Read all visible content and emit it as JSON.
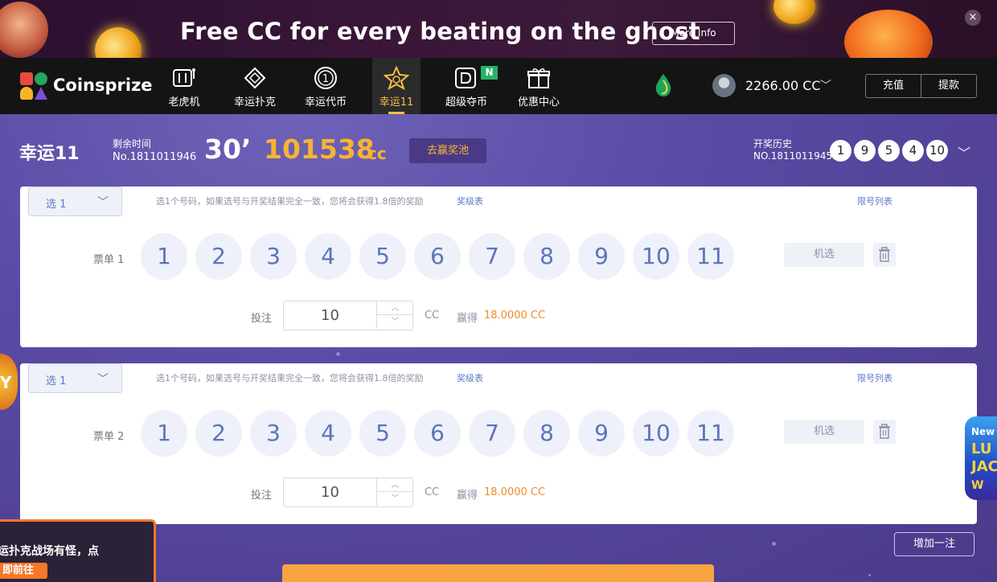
{
  "banner": {
    "title": "Free CC for every beating on the ghost",
    "more_info": "More Info",
    "close": "×"
  },
  "nav": {
    "logo_text": "Coinsprize",
    "items": [
      {
        "label": "老虎机",
        "icon": "slot-machine-icon"
      },
      {
        "label": "幸运扑克",
        "icon": "poker-icon"
      },
      {
        "label": "幸运代币",
        "icon": "coin-icon"
      },
      {
        "label": "幸运11",
        "icon": "star-icon"
      },
      {
        "label": "超级夺币",
        "icon": "super-coin-icon"
      },
      {
        "label": "优惠中心",
        "icon": "gift-icon"
      }
    ],
    "new_badge": "N",
    "balance": "2266.00 CC",
    "deposit": "充值",
    "withdraw": "提款"
  },
  "game": {
    "name": "幸运11",
    "remaining_label": "剩余时间",
    "draw_no": "No.1811011946",
    "countdown": "30’",
    "pool": "101538",
    "pool_unit": "cc",
    "pool_button": "去赢奖池",
    "history_label": "开奖历史",
    "history_no": "NO.1811011945",
    "history_balls": [
      "1",
      "9",
      "5",
      "4",
      "10"
    ]
  },
  "tickets": [
    {
      "select": "选 1",
      "rule": "选1个号码，如果选号与开奖结果完全一致，您将会获得1.8倍的奖励",
      "prize_table": "奖级表",
      "limit_list": "限号列表",
      "label": "票单 1",
      "numbers": [
        "1",
        "2",
        "3",
        "4",
        "5",
        "6",
        "7",
        "8",
        "9",
        "10",
        "11"
      ],
      "random": "机选",
      "bet_label": "投注",
      "bet_value": "10",
      "unit": "CC",
      "win_label": "赢得",
      "win_value": "18.0000 CC"
    },
    {
      "select": "选 1",
      "rule": "选1个号码，如果选号与开奖结果完全一致，您将会获得1.8倍的奖励",
      "prize_table": "奖级表",
      "limit_list": "限号列表",
      "label": "票单 2",
      "numbers": [
        "1",
        "2",
        "3",
        "4",
        "5",
        "6",
        "7",
        "8",
        "9",
        "10",
        "11"
      ],
      "random": "机选",
      "bet_label": "投注",
      "bet_value": "10",
      "unit": "CC",
      "win_label": "赢得",
      "win_value": "18.0000 CC"
    }
  ],
  "add_bet": "增加一注",
  "popup": {
    "text": "运扑克战场有怪，点",
    "button": "即前往"
  },
  "side_promo": {
    "line1": "New",
    "line2": "LU",
    "line3": "JAC",
    "line4": "W",
    "left_letter": "Y"
  },
  "colors": {
    "accent_gold": "#f6b431",
    "nav_active": "#f7c143",
    "number_text": "#5d74b9",
    "win_orange": "#f08a2c",
    "background_purple": "#5a4aa4"
  }
}
